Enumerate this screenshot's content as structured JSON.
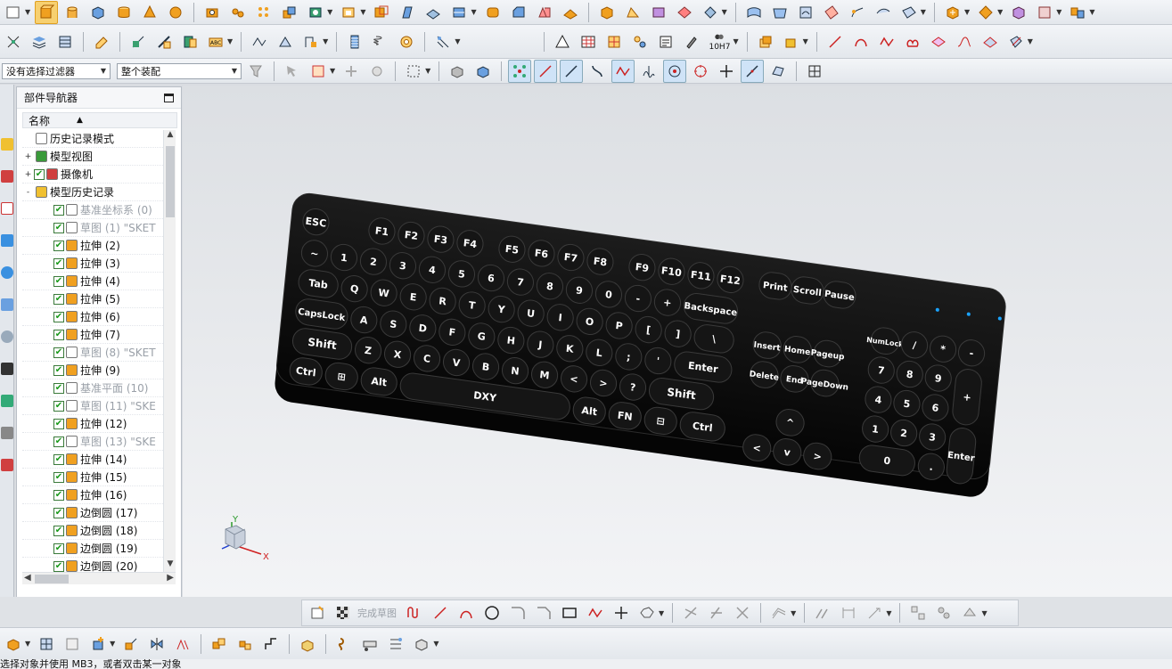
{
  "colors": {
    "accent": "#f0a020",
    "viewport_top": "#dcdfe3",
    "viewport_bottom": "#f3f4f6",
    "keyboard_body": "#0b0b0b",
    "key_face": "#151515",
    "key_text": "#ffffff",
    "led": "#1aa3ff",
    "check": "#1a9a1a"
  },
  "selectors": {
    "filter": "没有选择过滤器",
    "assembly": "整个装配"
  },
  "tool_labels": {
    "hole_ref": "10H7",
    "finish_sketch": "完成草图"
  },
  "nav": {
    "title": "部件导航器",
    "column_name": "名称",
    "items": [
      {
        "label": "历史记录模式",
        "icon": "clock-icon",
        "checked": false,
        "expand": "",
        "dim": false,
        "indent": 1
      },
      {
        "label": "模型视图",
        "icon": "model-view-icon",
        "checked": false,
        "expand": "+",
        "dim": false,
        "indent": 1
      },
      {
        "label": "摄像机",
        "icon": "camera-icon",
        "checked": true,
        "expand": "+",
        "dim": false,
        "indent": 1
      },
      {
        "label": "模型历史记录",
        "icon": "folder-icon",
        "checked": false,
        "expand": "-",
        "dim": false,
        "indent": 1
      },
      {
        "label": "基准坐标系 (0)",
        "icon": "datum-csys-icon",
        "checked": true,
        "expand": "",
        "dim": true,
        "indent": 2
      },
      {
        "label": "草图 (1) \"SKET",
        "icon": "sketch-icon",
        "checked": true,
        "expand": "",
        "dim": true,
        "indent": 2
      },
      {
        "label": "拉伸 (2)",
        "icon": "extrude-icon",
        "checked": true,
        "expand": "",
        "dim": false,
        "indent": 2
      },
      {
        "label": "拉伸 (3)",
        "icon": "extrude-icon",
        "checked": true,
        "expand": "",
        "dim": false,
        "indent": 2
      },
      {
        "label": "拉伸 (4)",
        "icon": "extrude-icon",
        "checked": true,
        "expand": "",
        "dim": false,
        "indent": 2
      },
      {
        "label": "拉伸 (5)",
        "icon": "extrude-icon",
        "checked": true,
        "expand": "",
        "dim": false,
        "indent": 2
      },
      {
        "label": "拉伸 (6)",
        "icon": "extrude-icon",
        "checked": true,
        "expand": "",
        "dim": false,
        "indent": 2
      },
      {
        "label": "拉伸 (7)",
        "icon": "extrude-icon",
        "checked": true,
        "expand": "",
        "dim": false,
        "indent": 2
      },
      {
        "label": "草图 (8) \"SKET",
        "icon": "sketch-icon",
        "checked": true,
        "expand": "",
        "dim": true,
        "indent": 2
      },
      {
        "label": "拉伸 (9)",
        "icon": "extrude-icon",
        "checked": true,
        "expand": "",
        "dim": false,
        "indent": 2
      },
      {
        "label": "基准平面 (10)",
        "icon": "datum-plane-icon",
        "checked": true,
        "expand": "",
        "dim": true,
        "indent": 2
      },
      {
        "label": "草图 (11) \"SKE",
        "icon": "sketch-icon",
        "checked": true,
        "expand": "",
        "dim": true,
        "indent": 2
      },
      {
        "label": "拉伸 (12)",
        "icon": "extrude-icon",
        "checked": true,
        "expand": "",
        "dim": false,
        "indent": 2
      },
      {
        "label": "草图 (13) \"SKE",
        "icon": "sketch-icon",
        "checked": true,
        "expand": "",
        "dim": true,
        "indent": 2
      },
      {
        "label": "拉伸 (14)",
        "icon": "extrude-icon",
        "checked": true,
        "expand": "",
        "dim": false,
        "indent": 2
      },
      {
        "label": "拉伸 (15)",
        "icon": "extrude-icon",
        "checked": true,
        "expand": "",
        "dim": false,
        "indent": 2
      },
      {
        "label": "拉伸 (16)",
        "icon": "extrude-icon",
        "checked": true,
        "expand": "",
        "dim": false,
        "indent": 2
      },
      {
        "label": "边倒圆 (17)",
        "icon": "edge-blend-icon",
        "checked": true,
        "expand": "",
        "dim": false,
        "indent": 2
      },
      {
        "label": "边倒圆 (18)",
        "icon": "edge-blend-icon",
        "checked": true,
        "expand": "",
        "dim": false,
        "indent": 2
      },
      {
        "label": "边倒圆 (19)",
        "icon": "edge-blend-icon",
        "checked": true,
        "expand": "",
        "dim": false,
        "indent": 2
      },
      {
        "label": "边倒圆 (20)",
        "icon": "edge-blend-icon",
        "checked": true,
        "expand": "",
        "dim": false,
        "indent": 2
      }
    ]
  },
  "keyboard": {
    "row_fn": [
      "ESC",
      "F1",
      "F2",
      "F3",
      "F4",
      "F5",
      "F6",
      "F7",
      "F8",
      "F9",
      "F10",
      "F11",
      "F12",
      "Print",
      "Scroll",
      "Pause"
    ],
    "row_num": [
      "~",
      "1",
      "2",
      "3",
      "4",
      "5",
      "6",
      "7",
      "8",
      "9",
      "0",
      "-",
      "+",
      "Backspace"
    ],
    "row_tab": [
      "Tab",
      "Q",
      "W",
      "E",
      "R",
      "T",
      "Y",
      "U",
      "I",
      "O",
      "P",
      "[",
      "]",
      "\\"
    ],
    "row_caps": [
      "CapsLock",
      "A",
      "S",
      "D",
      "F",
      "G",
      "H",
      "J",
      "K",
      "L",
      ";",
      "'",
      "Enter"
    ],
    "row_shift": [
      "Shift",
      "Z",
      "X",
      "C",
      "V",
      "B",
      "N",
      "M",
      "<",
      ">",
      "?",
      "Shift"
    ],
    "row_ctrl": [
      "Ctrl",
      "⊞",
      "Alt",
      "DXY",
      "Alt",
      "FN",
      "⊟",
      "Ctrl"
    ],
    "nav_top": [
      "Insert",
      "Home",
      "Pageup"
    ],
    "nav_bot": [
      "Delete",
      "End",
      "PageDown"
    ],
    "arrows": [
      "^",
      "<",
      "v",
      ">"
    ],
    "numpad": [
      "NumLock",
      "/",
      "*",
      "-",
      "7",
      "8",
      "9",
      "+",
      "4",
      "5",
      "6",
      "1",
      "2",
      "3",
      "Enter",
      "0",
      "."
    ]
  },
  "axis": {
    "x": "X",
    "y": "Y"
  },
  "status": "选择对象并使用 MB3，或者双击某一对象"
}
